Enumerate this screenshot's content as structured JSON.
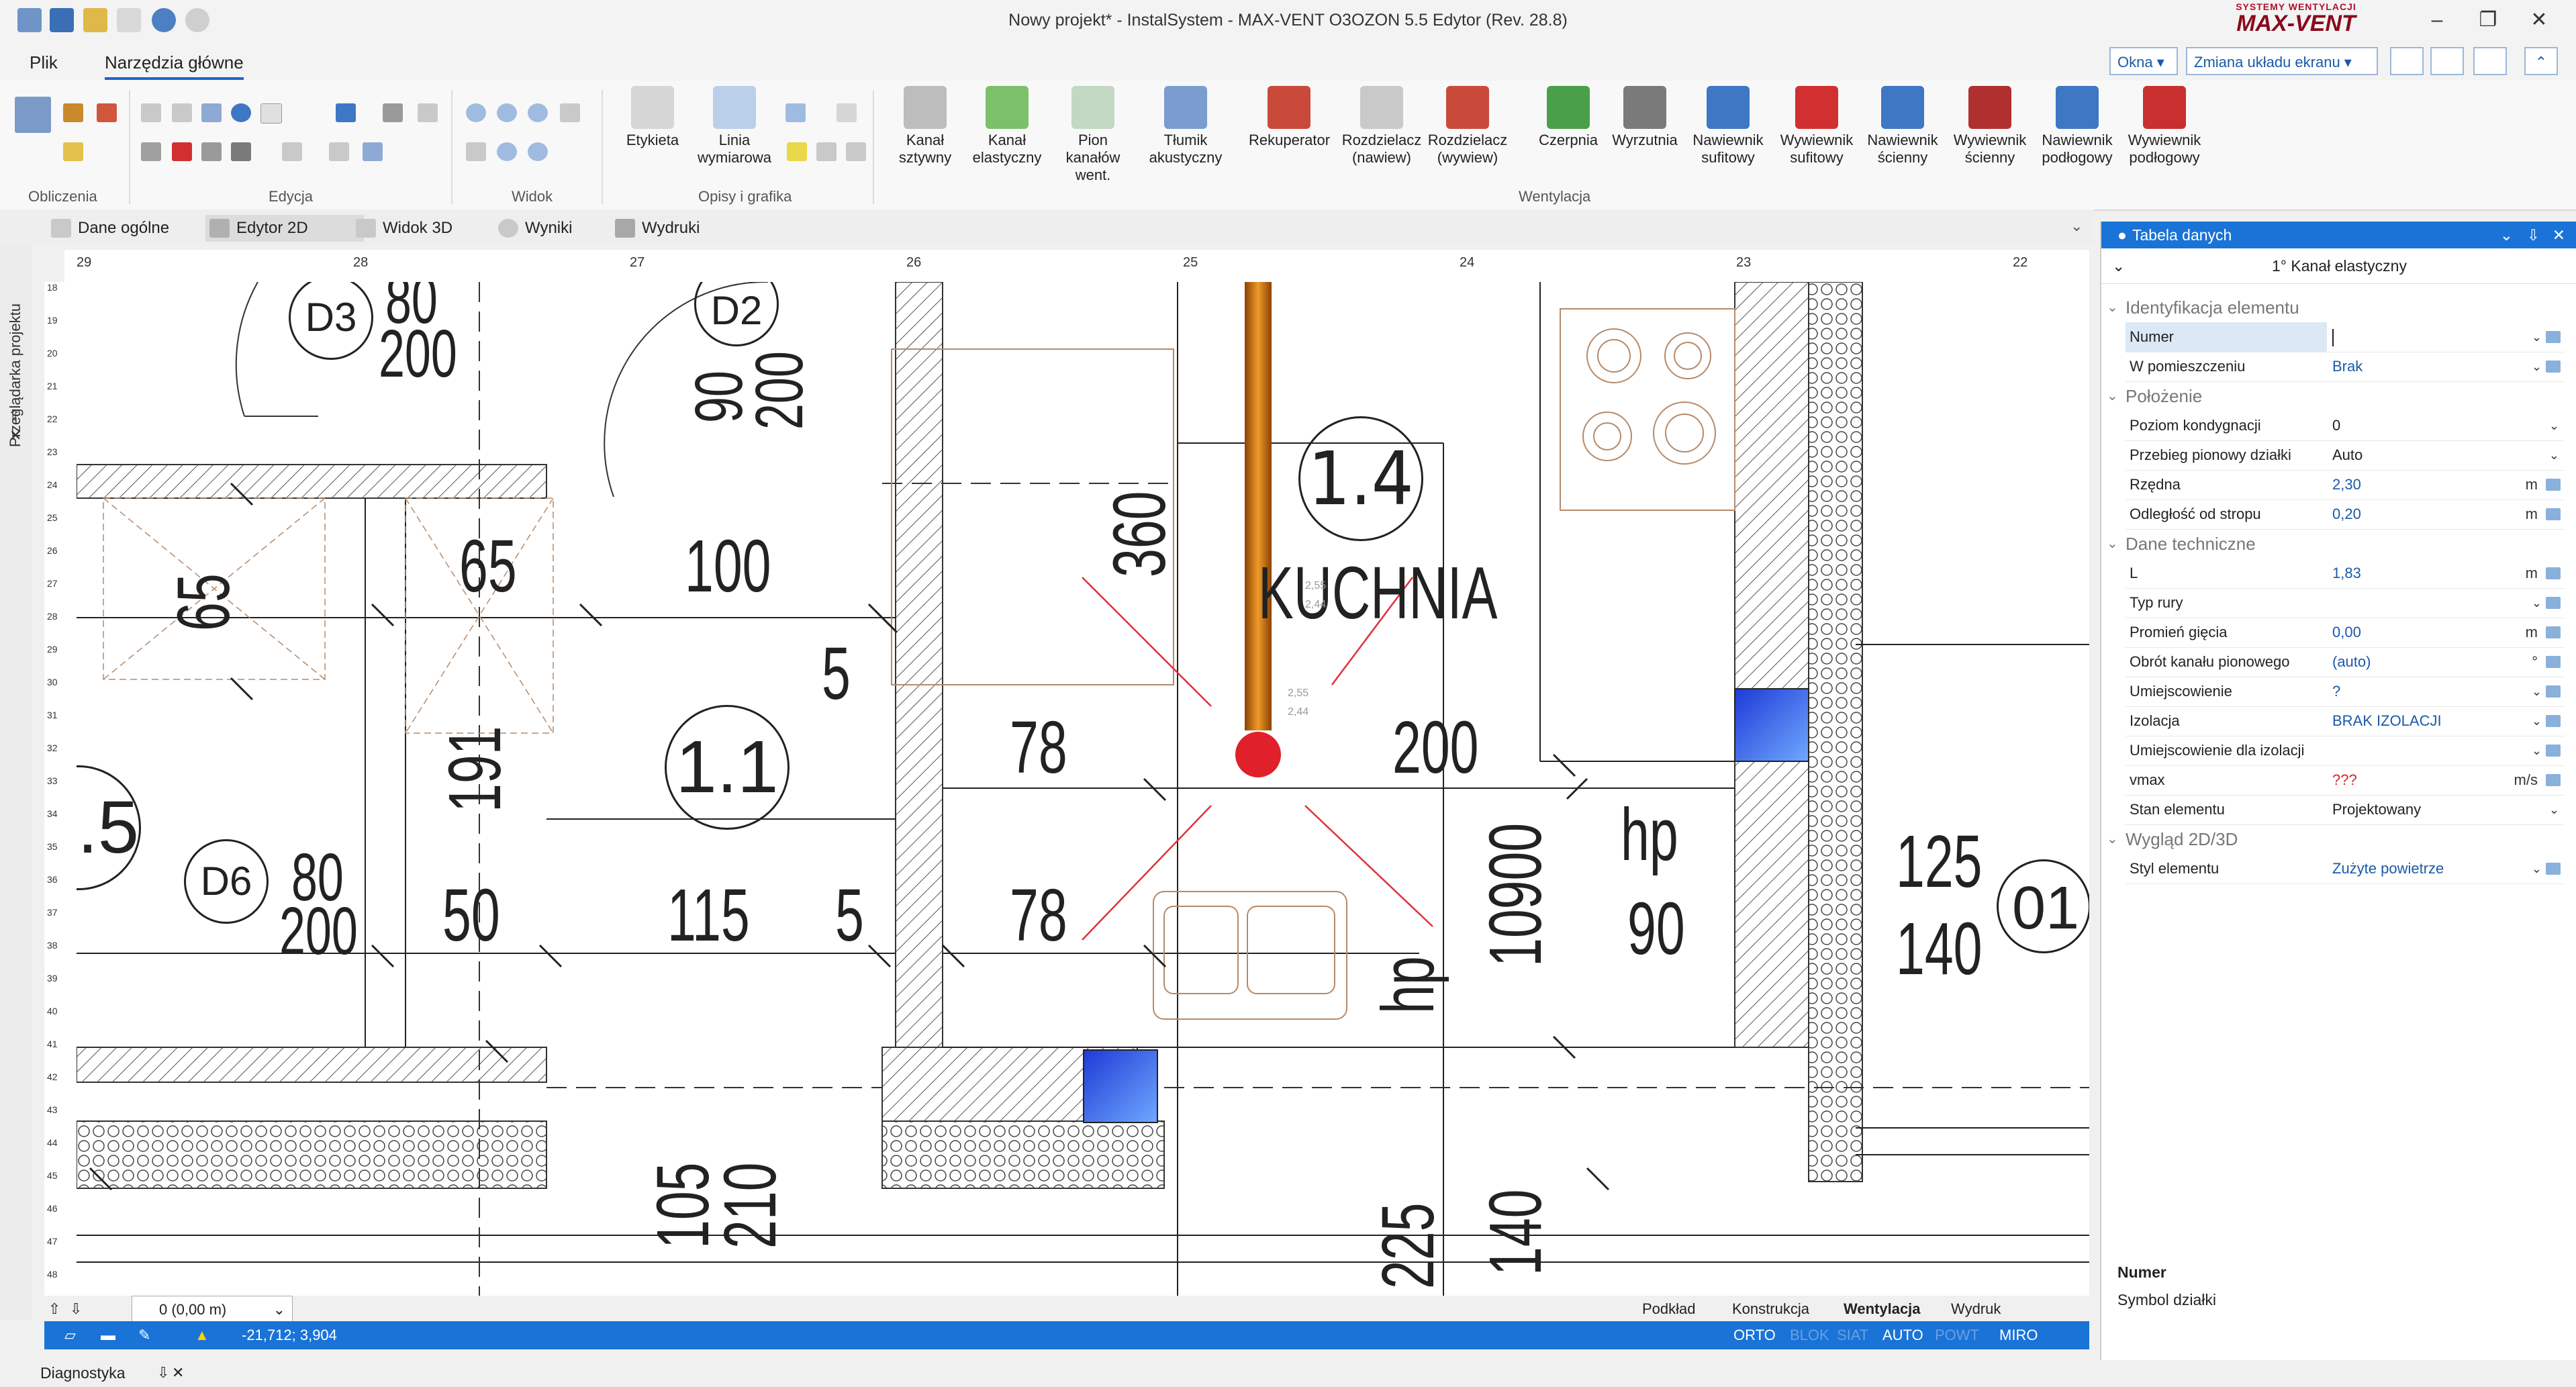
{
  "window": {
    "title": "Nowy projekt* - InstalSystem - MAX-VENT O3OZON 5.5 Edytor (Rev. 28.8)",
    "logo_top": "SYSTEMY WENTYLACJI",
    "logo_main": "MAX-VENT"
  },
  "menu": {
    "tabs": [
      "Plik",
      "Narzędzia główne"
    ],
    "okna": "Okna",
    "zmiana": "Zmiana układu ekranu"
  },
  "ribbon": {
    "groups": [
      "Obliczenia",
      "Edycja",
      "Widok",
      "Opisy i grafika",
      "Wentylacja"
    ],
    "etykieta": "Etykieta",
    "linia": [
      "Linia",
      "wymiarowa"
    ],
    "buttons": [
      {
        "l1": "Kanał",
        "l2": "sztywny"
      },
      {
        "l1": "Kanał",
        "l2": "elastyczny"
      },
      {
        "l1": "Pion kanałów",
        "l2": "went."
      },
      {
        "l1": "Tłumik",
        "l2": "akustyczny"
      },
      {
        "l1": "Rekuperator",
        "l2": ""
      },
      {
        "l1": "Rozdzielacz",
        "l2": "(nawiew)"
      },
      {
        "l1": "Rozdzielacz",
        "l2": "(wywiew)"
      },
      {
        "l1": "Czerpnia",
        "l2": ""
      },
      {
        "l1": "Wyrzutnia",
        "l2": ""
      },
      {
        "l1": "Nawiewnik",
        "l2": "sufitowy"
      },
      {
        "l1": "Wywiewnik",
        "l2": "sufitowy"
      },
      {
        "l1": "Nawiewnik",
        "l2": "ścienny"
      },
      {
        "l1": "Wywiewnik",
        "l2": "ścienny"
      },
      {
        "l1": "Nawiewnik",
        "l2": "podłogowy"
      },
      {
        "l1": "Wywiewnik",
        "l2": "podłogowy"
      }
    ]
  },
  "doc_tabs": [
    "Dane ogólne",
    "Edytor 2D",
    "Widok 3D",
    "Wyniki",
    "Wydruki"
  ],
  "left_sidebar": "Przeglądarka projektu",
  "ruler_top": [
    "29",
    "28",
    "27",
    "26",
    "25",
    "24",
    "23",
    "22"
  ],
  "ruler_left": [
    "18",
    "19",
    "20",
    "21",
    "22",
    "23",
    "24",
    "25",
    "26",
    "27",
    "28",
    "29",
    "30",
    "31",
    "32",
    "33",
    "34",
    "35",
    "36",
    "37",
    "38",
    "39",
    "40",
    "41",
    "42",
    "43",
    "44",
    "45",
    "46",
    "47",
    "48"
  ],
  "plan": {
    "rooms": [
      {
        "label": "1.4"
      },
      {
        "label": "1.1"
      },
      {
        "label": ".5"
      },
      {
        "label": "01"
      }
    ],
    "room_name": "KUCHNIA",
    "doors": [
      "D3",
      "D2",
      "D6"
    ],
    "dims": [
      "80",
      "200",
      "90",
      "200",
      "65",
      "65",
      "100",
      "360",
      "5",
      "191",
      "78",
      "200",
      "80",
      "200",
      "50",
      "115",
      "5",
      "78",
      "hp",
      "10900",
      "hp",
      "90",
      "125",
      "140",
      "105",
      "210",
      "225",
      "140"
    ],
    "small_marks": [
      "2,55",
      "2,44",
      "2,55",
      "2,44"
    ]
  },
  "layers": {
    "level": "0 (0,00 m)",
    "items": [
      "Podkład",
      "Konstrukcja",
      "Wentylacja",
      "Wydruk"
    ]
  },
  "status": {
    "coords": "-21,712; 3,904",
    "flags": [
      {
        "t": "ORTO",
        "on": true
      },
      {
        "t": "BLOK",
        "on": false
      },
      {
        "t": "SIAT",
        "on": false
      },
      {
        "t": "AUTO",
        "on": true
      },
      {
        "t": "POWT",
        "on": false
      },
      {
        "t": "MIRO",
        "on": true
      }
    ]
  },
  "diag": "Diagnostyka",
  "panel": {
    "title": "Tabela danych",
    "subtitle": "1° Kanał elastyczny",
    "sections": [
      {
        "name": "Identyfikacja elementu",
        "rows": [
          {
            "label": "Numer",
            "value": "",
            "unit": "",
            "dd": true,
            "ed": true,
            "sel": true
          },
          {
            "label": "W pomieszczeniu",
            "value": "Brak",
            "unit": "",
            "dd": true,
            "ed": true
          }
        ]
      },
      {
        "name": "Położenie",
        "rows": [
          {
            "label": "Poziom kondygnacji",
            "value": "0",
            "unit": "",
            "dd": true,
            "ed": false,
            "dark": true
          },
          {
            "label": "Przebieg pionowy działki",
            "value": "Auto",
            "unit": "",
            "dd": true,
            "ed": false,
            "dark": true
          },
          {
            "label": "Rzędna",
            "value": "2,30",
            "unit": "m",
            "dd": false,
            "ed": true
          },
          {
            "label": "Odległość od stropu",
            "value": "0,20",
            "unit": "m",
            "dd": false,
            "ed": true
          }
        ]
      },
      {
        "name": "Dane techniczne",
        "rows": [
          {
            "label": "L",
            "value": "1,83",
            "unit": "m",
            "dd": false,
            "ed": true
          },
          {
            "label": "Typ rury",
            "value": "",
            "unit": "",
            "dd": true,
            "ed": true
          },
          {
            "label": "Promień gięcia",
            "value": "0,00",
            "unit": "m",
            "dd": false,
            "ed": true
          },
          {
            "label": "Obrót kanału pionowego",
            "value": "(auto)",
            "unit": "°",
            "dd": false,
            "ed": true
          },
          {
            "label": "Umiejscowienie",
            "value": "?",
            "unit": "",
            "dd": true,
            "ed": true
          },
          {
            "label": "Izolacja",
            "value": "BRAK IZOLACJI",
            "unit": "",
            "dd": true,
            "ed": true
          },
          {
            "label": "Umiejscowienie dla izolacji",
            "value": "",
            "unit": "",
            "dd": true,
            "ed": true
          },
          {
            "label": "vmax",
            "value": "???",
            "unit": "m/s",
            "dd": false,
            "ed": true,
            "red": true
          },
          {
            "label": "Stan elementu",
            "value": "Projektowany",
            "unit": "",
            "dd": true,
            "ed": false,
            "dark": true
          }
        ]
      },
      {
        "name": "Wygląd 2D/3D",
        "rows": [
          {
            "label": "Styl elementu",
            "value": "Zużyte powietrze",
            "unit": "",
            "dd": true,
            "ed": true
          }
        ]
      }
    ],
    "desc_title": "Numer",
    "desc_text": "Symbol działki"
  }
}
